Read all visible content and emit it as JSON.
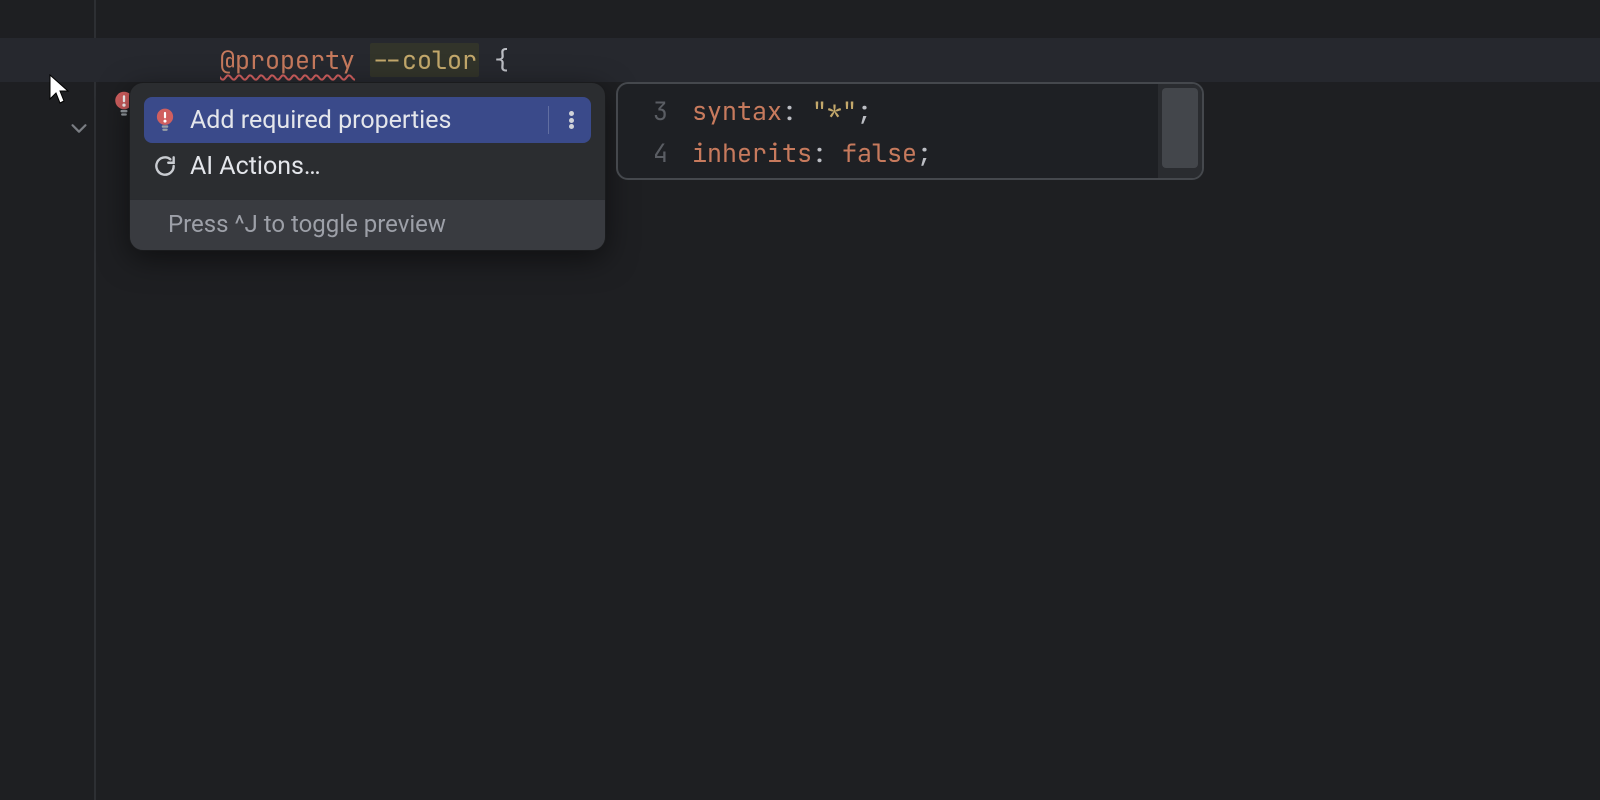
{
  "code": {
    "line1": {
      "atrule": "@property",
      "space1": " ",
      "ident": "--color",
      "space2": " ",
      "brace_open": "{"
    },
    "line3": {
      "brace_close": "}"
    }
  },
  "intention_popup": {
    "items": [
      {
        "icon": "bulb-error-icon",
        "label": "Add required properties"
      },
      {
        "icon": "ai-refresh-icon",
        "label": "AI Actions…"
      }
    ],
    "footer": "Press ^J to toggle preview"
  },
  "preview": {
    "lines": [
      {
        "num": "3",
        "prop": "syntax",
        "colon": ": ",
        "value_str": "\"*\"",
        "semi": ";"
      },
      {
        "num": "4",
        "prop": "inherits",
        "colon": ": ",
        "value_kw": "false",
        "semi": ";"
      }
    ]
  }
}
